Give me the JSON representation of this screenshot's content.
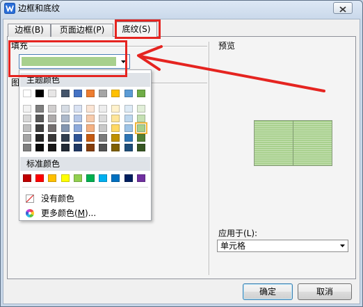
{
  "window": {
    "title": "边框和底纹",
    "app_icon": "wps-writer-icon",
    "close_icon": "close-icon"
  },
  "tabs": [
    {
      "label": "边框(B)",
      "active": false
    },
    {
      "label": "页面边框(P)",
      "active": false
    },
    {
      "label": "底纹(S)",
      "active": true
    }
  ],
  "fill": {
    "label": "填充",
    "selected_color": "#a8d08d",
    "dropdown_icon": "chevron-down-icon"
  },
  "pattern": {
    "label": "图"
  },
  "color_picker": {
    "theme_header": "主题颜色",
    "theme_colors": [
      "#ffffff",
      "#000000",
      "#e7e6e6",
      "#44546a",
      "#4472c4",
      "#ed7d31",
      "#a5a5a5",
      "#ffc000",
      "#5b9bd5",
      "#70ad47"
    ],
    "shade_rows": [
      [
        "#f2f2f2",
        "#7f7f7f",
        "#d0cece",
        "#d6dce4",
        "#d9e2f3",
        "#fbe5d5",
        "#ededed",
        "#fff2cc",
        "#deebf6",
        "#e2efd9"
      ],
      [
        "#d8d8d8",
        "#595959",
        "#aeabab",
        "#adb9ca",
        "#b4c6e7",
        "#f7cbac",
        "#dbdbdb",
        "#fee599",
        "#bdd7ee",
        "#c5e0b3"
      ],
      [
        "#bfbfbf",
        "#3f3f3f",
        "#757070",
        "#8496b0",
        "#8eaadb",
        "#f4b183",
        "#c9c9c9",
        "#ffd965",
        "#9dc3e6",
        "#a8d08d"
      ],
      [
        "#a5a5a5",
        "#262626",
        "#3a3838",
        "#323f4f",
        "#2f5496",
        "#c55a11",
        "#7b7b7b",
        "#bf9000",
        "#2e75b5",
        "#538135"
      ],
      [
        "#7f7f7f",
        "#0c0c0c",
        "#171616",
        "#222a35",
        "#1f3864",
        "#833c0b",
        "#525252",
        "#7f6000",
        "#1e4e79",
        "#375623"
      ]
    ],
    "standard_header": "标准颜色",
    "standard_colors": [
      "#c00000",
      "#ff0000",
      "#ffc000",
      "#ffff00",
      "#92d050",
      "#00b050",
      "#00b0f0",
      "#0070c0",
      "#002060",
      "#7030a0"
    ],
    "no_color": {
      "label": "没有颜色",
      "icon": "no-color-icon"
    },
    "more_colors": {
      "label": "更多颜色(M)...",
      "icon": "color-wheel-icon"
    }
  },
  "preview": {
    "label": "预览",
    "fill_color": "#a8d08d"
  },
  "apply_to": {
    "label": "应用于(L):",
    "value": "单元格",
    "dropdown_icon": "chevron-down-icon"
  },
  "buttons": {
    "ok": "确定",
    "cancel": "取消"
  },
  "annotations": {
    "color": "#e52420",
    "arrow_icon": "red-arrow-icon"
  }
}
